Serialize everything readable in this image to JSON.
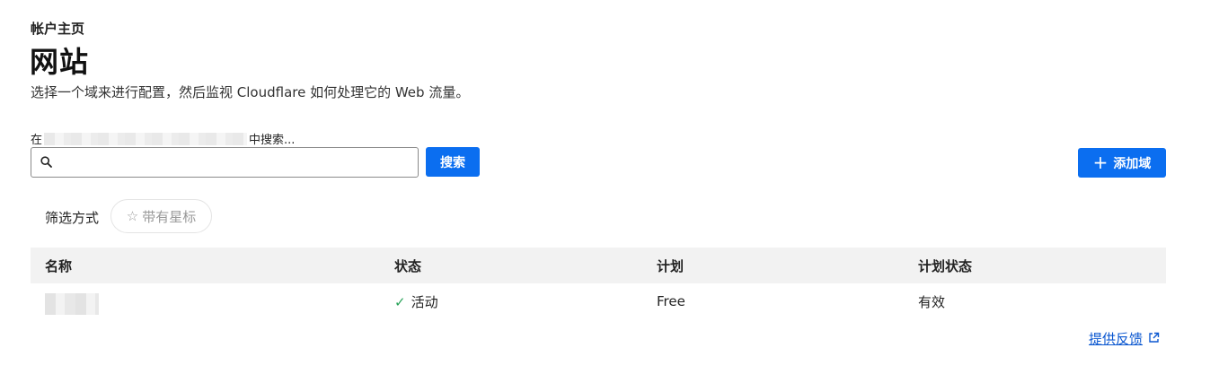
{
  "header": {
    "breadcrumb": "帐户主页",
    "title": "网站",
    "description": "选择一个域来进行配置，然后监视 Cloudflare 如何处理它的 Web 流量。"
  },
  "search": {
    "label_prefix": "在",
    "label_suffix": "中搜索...",
    "placeholder": "",
    "value": "",
    "button_label": "搜索"
  },
  "actions": {
    "add_domain_label": "添加域"
  },
  "filter": {
    "label": "筛选方式",
    "starred_label": "带有星标"
  },
  "table": {
    "columns": [
      "名称",
      "状态",
      "计划",
      "计划状态"
    ],
    "rows": [
      {
        "name": "",
        "status": "活动",
        "plan": "Free",
        "plan_status": "有效"
      }
    ]
  },
  "footer": {
    "feedback_label": "提供反馈"
  },
  "colors": {
    "primary": "#0b6ef0",
    "status_ok": "#2aa35a",
    "link": "#0b57d0"
  }
}
